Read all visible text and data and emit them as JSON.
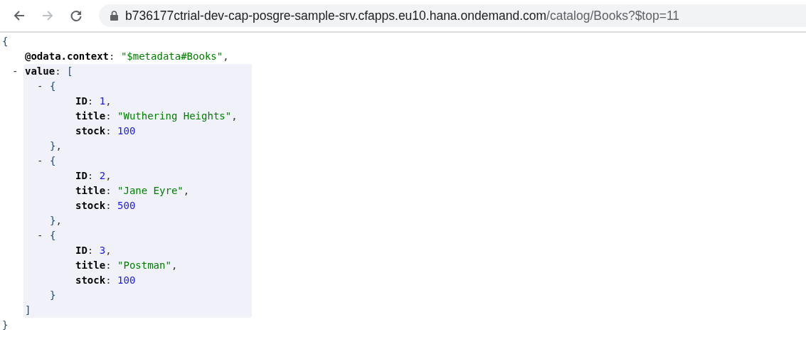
{
  "browser": {
    "back_enabled": true,
    "forward_enabled": false,
    "url_host": "b736177ctrial-dev-cap-posgre-sample-srv.cfapps.eu10.hana.ondemand.com",
    "url_path": "/catalog/Books?$top=11"
  },
  "document": {
    "open": "{",
    "close": "}",
    "members": [
      {
        "kind": "field",
        "key": "@odata.context",
        "colon": ":",
        "value": "\"$metadata#Books\"",
        "color": "#008000",
        "comma": ","
      },
      {
        "kind": "block",
        "toggle": "-",
        "expanded": true,
        "highlighted": true,
        "key": "value",
        "colon": ":",
        "open": "[",
        "close": "]",
        "members": [
          {
            "kind": "block",
            "toggle": "-",
            "expanded": true,
            "highlighted": false,
            "open": "{",
            "close": "}",
            "comma": ",",
            "members": [
              {
                "kind": "field",
                "key": "ID",
                "colon": ":",
                "value": "1",
                "color": "#1a1aff",
                "comma": ","
              },
              {
                "kind": "field",
                "key": "title",
                "colon": ":",
                "value": "\"Wuthering Heights\"",
                "color": "#008000",
                "comma": ","
              },
              {
                "kind": "field",
                "key": "stock",
                "colon": ":",
                "value": "100",
                "color": "#1a1aff"
              }
            ]
          },
          {
            "kind": "block",
            "toggle": "-",
            "expanded": true,
            "highlighted": false,
            "open": "{",
            "close": "}",
            "comma": ",",
            "members": [
              {
                "kind": "field",
                "key": "ID",
                "colon": ":",
                "value": "2",
                "color": "#1a1aff",
                "comma": ","
              },
              {
                "kind": "field",
                "key": "title",
                "colon": ":",
                "value": "\"Jane Eyre\"",
                "color": "#008000",
                "comma": ","
              },
              {
                "kind": "field",
                "key": "stock",
                "colon": ":",
                "value": "500",
                "color": "#1a1aff"
              }
            ]
          },
          {
            "kind": "block",
            "toggle": "-",
            "expanded": true,
            "highlighted": false,
            "open": "{",
            "close": "}",
            "members": [
              {
                "kind": "field",
                "key": "ID",
                "colon": ":",
                "value": "3",
                "color": "#1a1aff",
                "comma": ","
              },
              {
                "kind": "field",
                "key": "title",
                "colon": ":",
                "value": "\"Postman\"",
                "color": "#008000",
                "comma": ","
              },
              {
                "kind": "field",
                "key": "stock",
                "colon": ":",
                "value": "100",
                "color": "#1a1aff"
              }
            ]
          }
        ]
      }
    ]
  }
}
